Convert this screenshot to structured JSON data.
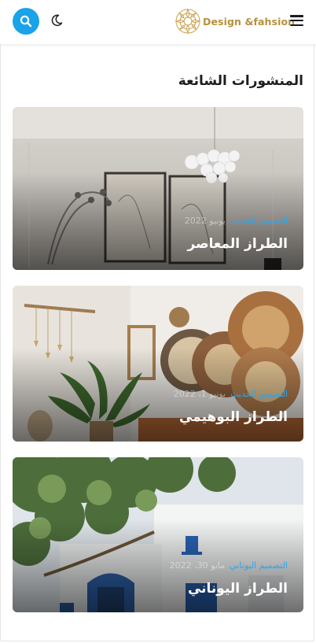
{
  "header": {
    "brand_name": "Design &fahsion",
    "accent_color": "#1aa3e8",
    "brand_color": "#b8913e"
  },
  "section": {
    "title": "المنشورات الشائعة"
  },
  "posts": [
    {
      "title": "الطراز المعاصر",
      "category": "التصميم الحديث",
      "date": "يونيو 2022"
    },
    {
      "title": "الطراز البوهيمي",
      "category": "التصميم الحديث",
      "date": "يونيو 1، 2022"
    },
    {
      "title": "الطراز اليوناني",
      "category": "التصميم اليوناني",
      "date": "مايو 30، 2022"
    }
  ]
}
